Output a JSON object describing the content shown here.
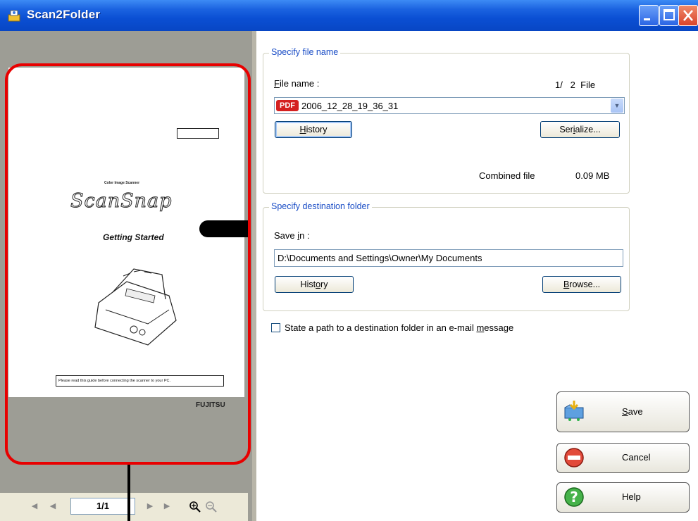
{
  "window": {
    "title": "Scan2Folder"
  },
  "preview": {
    "document": {
      "label_small": "Color Image Scanner",
      "logo": "ScanSnap",
      "title": "Getting Started",
      "note": "Please read this guide before connecting the scanner to your PC.",
      "brand": "FUJITSU"
    },
    "page_indicator": "1/1"
  },
  "file_group": {
    "title": "Specify file name",
    "file_name_label_pre": "",
    "file_name_label_u": "F",
    "file_name_label_rest": "ile name :",
    "counter": "1/   2  File",
    "selected_file": "2006_12_28_19_36_31",
    "file_type_badge": "PDF",
    "history_label_pre": "",
    "history_label_u": "H",
    "history_label_rest": "istory",
    "serialize_label_pre": "Ser",
    "serialize_label_u": "i",
    "serialize_label_rest": "alize...",
    "combined_label": "Combined file",
    "combined_size": "0.09 MB"
  },
  "dest_group": {
    "title": "Specify destination folder",
    "save_in_pre": "Save ",
    "save_in_u": "i",
    "save_in_rest": "n :",
    "path": "D:\\Documents and Settings\\Owner\\My Documents",
    "history_label_pre": "Hist",
    "history_label_u": "o",
    "history_label_rest": "ry",
    "browse_label_pre": "",
    "browse_label_u": "B",
    "browse_label_rest": "rowse..."
  },
  "email_option": {
    "label_pre": "State a path to a destination folder in an e-mail ",
    "label_u": "m",
    "label_rest": "essage",
    "checked": false
  },
  "actions": {
    "save_pre": "",
    "save_u": "S",
    "save_rest": "ave",
    "cancel": "Cancel",
    "help": "Help"
  },
  "colors": {
    "title_bar": "#0a4fd3",
    "annotation_frame": "#e80000",
    "group_title": "#1a4dc6",
    "preview_background": "#9d9d95"
  }
}
